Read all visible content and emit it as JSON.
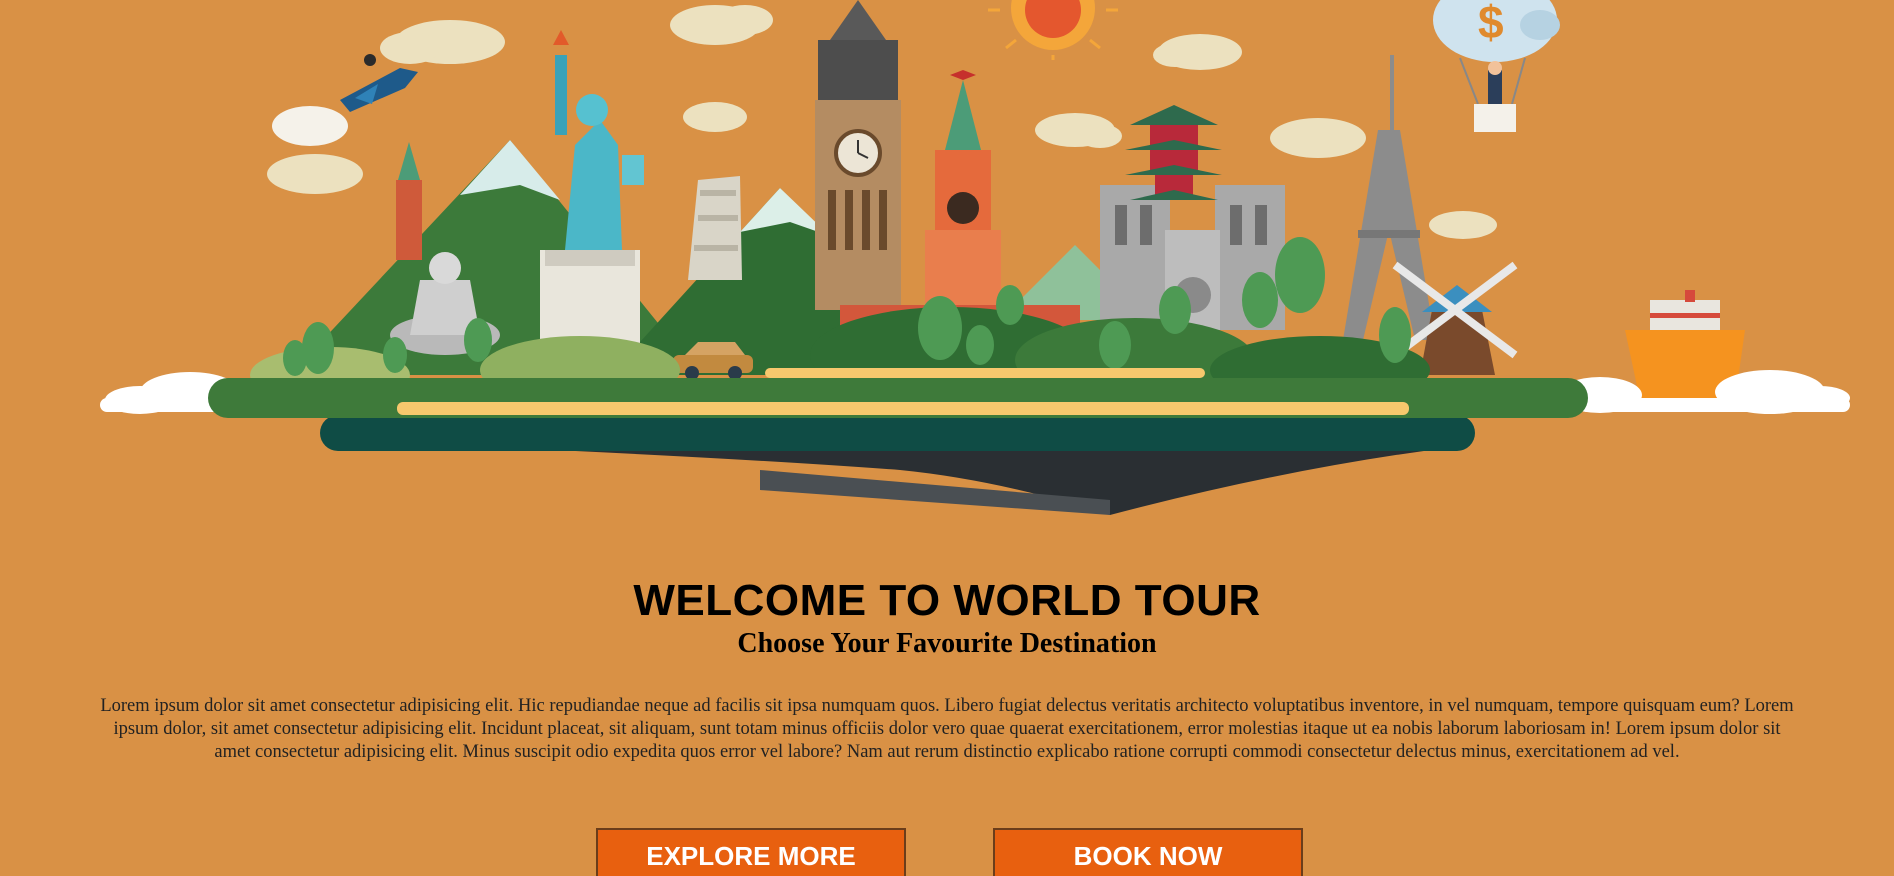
{
  "hero": {
    "currency_symbol": "$"
  },
  "main": {
    "title": "WELCOME TO WORLD TOUR",
    "subtitle": "Choose Your Favourite Destination",
    "description": "Lorem ipsum dolor sit amet consectetur adipisicing elit. Hic repudiandae neque ad facilis sit ipsa numquam quos. Libero fugiat delectus veritatis architecto voluptatibus inventore, in vel numquam, tempore quisquam eum? Lorem ipsum dolor, sit amet consectetur adipisicing elit. Incidunt placeat, sit aliquam, sunt totam minus officiis dolor vero quae quaerat exercitationem, error molestias itaque ut ea nobis laborum laboriosam in! Lorem ipsum dolor sit amet consectetur adipisicing elit. Minus suscipit odio expedita quos error vel labore? Nam aut rerum distinctio explicabo ratione corrupti commodi consectetur delectus minus, exercitationem ad vel."
  },
  "buttons": {
    "explore_label": "EXPLORE MORE",
    "book_label": "BOOK NOW"
  },
  "colors": {
    "background": "#d99145",
    "button": "#e8600f",
    "island_green": "#3e7a3a",
    "island_teal": "#0f4c45"
  }
}
